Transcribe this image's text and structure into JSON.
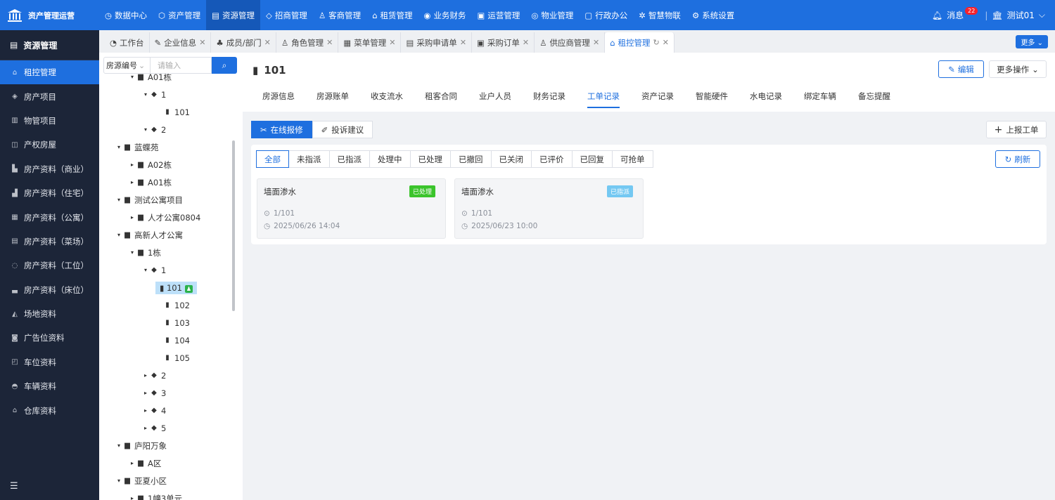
{
  "app": {
    "title": "资产管理运营"
  },
  "topnav": [
    {
      "label": "数据中心",
      "icon": "◷"
    },
    {
      "label": "资产管理",
      "icon": "⬡"
    },
    {
      "label": "资源管理",
      "icon": "▤",
      "active": true
    },
    {
      "label": "招商管理",
      "icon": "◇"
    },
    {
      "label": "客商管理",
      "icon": "♙"
    },
    {
      "label": "租赁管理",
      "icon": "⌂"
    },
    {
      "label": "业务财务",
      "icon": "◉"
    },
    {
      "label": "运营管理",
      "icon": "▣"
    },
    {
      "label": "物业管理",
      "icon": "◎"
    },
    {
      "label": "行政办公",
      "icon": "▢"
    },
    {
      "label": "智慧物联",
      "icon": "✲"
    },
    {
      "label": "系统设置",
      "icon": "⚙"
    }
  ],
  "topright": {
    "messages": "消息",
    "badge": "22",
    "user": "测试01"
  },
  "sidebar": {
    "title": "资源管理",
    "items": [
      {
        "label": "租控管理",
        "icon": "⌂",
        "active": true
      },
      {
        "label": "房产项目",
        "icon": "◈"
      },
      {
        "label": "物管项目",
        "icon": "▥"
      },
      {
        "label": "产权房屋",
        "icon": "◫"
      },
      {
        "label": "房产资料（商业）",
        "icon": "▙"
      },
      {
        "label": "房产资料（住宅）",
        "icon": "▟"
      },
      {
        "label": "房产资料（公寓）",
        "icon": "▦"
      },
      {
        "label": "房产资料（菜场）",
        "icon": "▤"
      },
      {
        "label": "房产资料（工位）",
        "icon": "◌"
      },
      {
        "label": "房产资料（床位）",
        "icon": "▃"
      },
      {
        "label": "场地资料",
        "icon": "◭"
      },
      {
        "label": "广告位资料",
        "icon": "◙"
      },
      {
        "label": "车位资料",
        "icon": "◰"
      },
      {
        "label": "车辆资料",
        "icon": "◓"
      },
      {
        "label": "仓库资料",
        "icon": "⌂"
      }
    ]
  },
  "tabs": [
    {
      "label": "工作台",
      "icon": "◔",
      "closable": false
    },
    {
      "label": "企业信息",
      "icon": "✎",
      "closable": true
    },
    {
      "label": "成员/部门",
      "icon": "♣",
      "closable": true
    },
    {
      "label": "角色管理",
      "icon": "♙",
      "closable": true
    },
    {
      "label": "菜单管理",
      "icon": "▦",
      "closable": true
    },
    {
      "label": "采购申请单",
      "icon": "▤",
      "closable": true
    },
    {
      "label": "采购订单",
      "icon": "▣",
      "closable": true
    },
    {
      "label": "供应商管理",
      "icon": "♙",
      "closable": true
    },
    {
      "label": "租控管理",
      "icon": "⌂",
      "closable": true,
      "active": true
    }
  ],
  "more_label": "更多",
  "search": {
    "select": "房源编号",
    "placeholder": "请输入"
  },
  "tree": [
    {
      "level": 2,
      "arrow": "▾",
      "icon": "▆",
      "label": "A01栋"
    },
    {
      "level": 3,
      "arrow": "▾",
      "icon": "◆",
      "label": "1"
    },
    {
      "level": 4,
      "arrow": "",
      "icon": "▮",
      "label": "101"
    },
    {
      "level": 3,
      "arrow": "▾",
      "icon": "◆",
      "label": "2"
    },
    {
      "level": 1,
      "arrow": "▾",
      "icon": "▆",
      "label": "蓝蝶苑"
    },
    {
      "level": 2,
      "arrow": "▸",
      "icon": "▆",
      "label": "A02栋"
    },
    {
      "level": 2,
      "arrow": "▸",
      "icon": "▆",
      "label": "A01栋"
    },
    {
      "level": 1,
      "arrow": "▾",
      "icon": "▆",
      "label": "测试公寓项目"
    },
    {
      "level": 2,
      "arrow": "▸",
      "icon": "▆",
      "label": "人才公寓0804"
    },
    {
      "level": 1,
      "arrow": "▾",
      "icon": "▆",
      "label": "高新人才公寓"
    },
    {
      "level": 2,
      "arrow": "▾",
      "icon": "▆",
      "label": "1栋"
    },
    {
      "level": 3,
      "arrow": "▾",
      "icon": "◆",
      "label": "1"
    },
    {
      "level": 4,
      "arrow": "",
      "icon": "▮",
      "label": "101",
      "selected": true
    },
    {
      "level": 4,
      "arrow": "",
      "icon": "▮",
      "label": "102"
    },
    {
      "level": 4,
      "arrow": "",
      "icon": "▮",
      "label": "103"
    },
    {
      "level": 4,
      "arrow": "",
      "icon": "▮",
      "label": "104"
    },
    {
      "level": 4,
      "arrow": "",
      "icon": "▮",
      "label": "105"
    },
    {
      "level": 3,
      "arrow": "▸",
      "icon": "◆",
      "label": "2"
    },
    {
      "level": 3,
      "arrow": "▸",
      "icon": "◆",
      "label": "3"
    },
    {
      "level": 3,
      "arrow": "▸",
      "icon": "◆",
      "label": "4"
    },
    {
      "level": 3,
      "arrow": "▸",
      "icon": "◆",
      "label": "5"
    },
    {
      "level": 1,
      "arrow": "▾",
      "icon": "▆",
      "label": "庐阳万象"
    },
    {
      "level": 2,
      "arrow": "▸",
      "icon": "▆",
      "label": "A区"
    },
    {
      "level": 1,
      "arrow": "▾",
      "icon": "▆",
      "label": "亚夏小区"
    },
    {
      "level": 2,
      "arrow": "▸",
      "icon": "▆",
      "label": "1幢3单元"
    }
  ],
  "room": {
    "title": "101",
    "edit": "编辑",
    "more_ops": "更多操作"
  },
  "subtabs": [
    "房源信息",
    "房源账单",
    "收支流水",
    "租客合同",
    "业户人员",
    "财务记录",
    "工单记录",
    "资产记录",
    "智能硬件",
    "水电记录",
    "绑定车辆",
    "备忘提醒"
  ],
  "subtab_active": "工单记录",
  "section": {
    "repair": "在线报修",
    "complaint": "投诉建议",
    "report": "上报工单"
  },
  "filters": [
    "全部",
    "未指派",
    "已指派",
    "处理中",
    "已处理",
    "已撤回",
    "已关闭",
    "已评价",
    "已回复",
    "可抢单"
  ],
  "filter_active": "全部",
  "refresh": "刷新",
  "orders": [
    {
      "title": "墙面渗水",
      "status": "已处理",
      "status_color": "#3bc42c",
      "location": "1/101",
      "time": "2025/06/26 14:04"
    },
    {
      "title": "墙面渗水",
      "status": "已指派",
      "status_color": "#74c8f2",
      "location": "1/101",
      "time": "2025/06/23 10:00"
    }
  ]
}
